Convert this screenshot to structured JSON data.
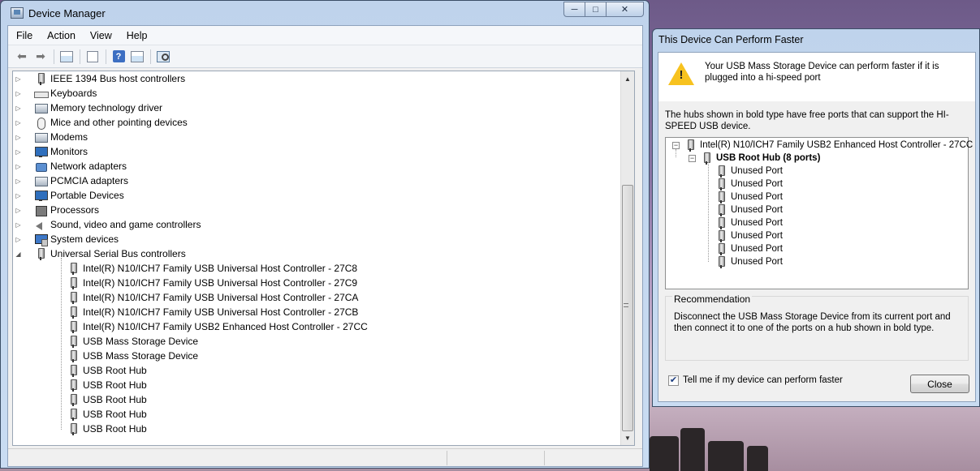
{
  "device_manager": {
    "title": "Device Manager",
    "menu": [
      "File",
      "Action",
      "View",
      "Help"
    ],
    "toolbar_icons": [
      "back-icon",
      "forward-icon",
      "show-hide-console-tree-icon",
      "properties-icon",
      "help-icon",
      "console-properties-icon",
      "scan-hardware-icon"
    ],
    "categories": [
      {
        "label": "IEEE 1394 Bus host controllers",
        "icon": "usb-icon"
      },
      {
        "label": "Keyboards",
        "icon": "keyboard-icon"
      },
      {
        "label": "Memory technology driver",
        "icon": "box-icon"
      },
      {
        "label": "Mice and other pointing devices",
        "icon": "mouse-icon"
      },
      {
        "label": "Modems",
        "icon": "box-icon"
      },
      {
        "label": "Monitors",
        "icon": "monitor-icon"
      },
      {
        "label": "Network adapters",
        "icon": "network-icon"
      },
      {
        "label": "PCMCIA adapters",
        "icon": "box-icon"
      },
      {
        "label": "Portable Devices",
        "icon": "monitor-icon"
      },
      {
        "label": "Processors",
        "icon": "chip-icon"
      },
      {
        "label": "Sound, video and game controllers",
        "icon": "sound-icon"
      },
      {
        "label": "System devices",
        "icon": "system-icon"
      },
      {
        "label": "Universal Serial Bus controllers",
        "icon": "usb-icon"
      }
    ],
    "usb_children": [
      "Intel(R) N10/ICH7 Family USB Universal Host Controller - 27C8",
      "Intel(R) N10/ICH7 Family USB Universal Host Controller - 27C9",
      "Intel(R) N10/ICH7 Family USB Universal Host Controller - 27CA",
      "Intel(R) N10/ICH7 Family USB Universal Host Controller - 27CB",
      "Intel(R) N10/ICH7 Family USB2 Enhanced Host Controller - 27CC",
      "USB Mass Storage Device",
      "USB Mass Storage Device",
      "USB Root Hub",
      "USB Root Hub",
      "USB Root Hub",
      "USB Root Hub",
      "USB Root Hub"
    ]
  },
  "dialog": {
    "title": "This Device Can Perform Faster",
    "warning": "Your USB Mass Storage Device can perform faster if it is plugged into a hi-speed port",
    "hubs_description": "The hubs shown in bold type have free ports that can support the HI-SPEED USB device.",
    "controller": "Intel(R) N10/ICH7 Family USB2 Enhanced Host Controller - 27CC",
    "root_hub": "USB Root Hub (8 ports)",
    "ports": [
      "Unused Port",
      "Unused Port",
      "Unused Port",
      "Unused Port",
      "Unused Port",
      "Unused Port",
      "Unused Port",
      "Unused Port"
    ],
    "recommendation_title": "Recommendation",
    "recommendation_text": "Disconnect the USB Mass Storage Device from its current port and then connect it to one of the ports on a hub shown in bold type.",
    "checkbox_label": "Tell me if my device can perform faster",
    "checkbox_checked": true,
    "close_label": "Close"
  }
}
